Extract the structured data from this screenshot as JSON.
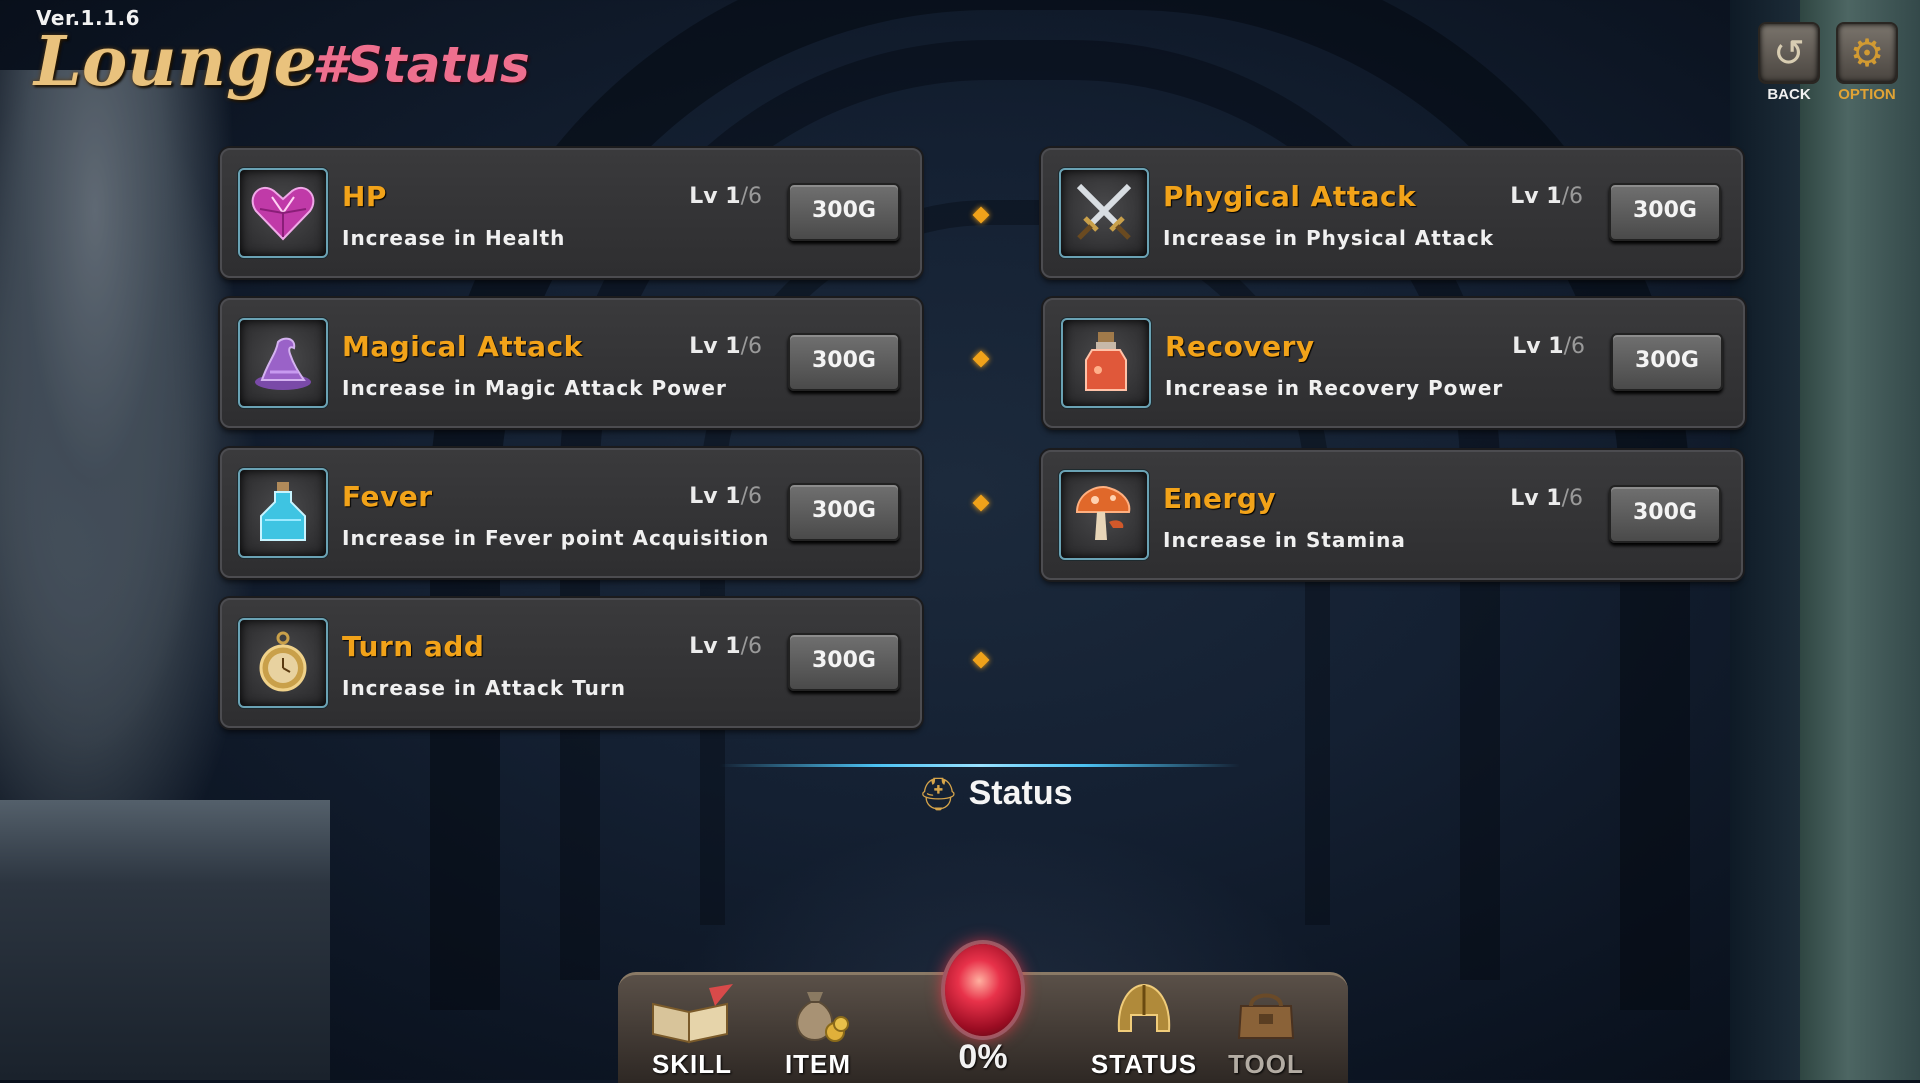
{
  "header": {
    "version": "Ver.1.1.6",
    "title": "Lounge",
    "subtitle": "#Status"
  },
  "top_buttons": {
    "back_label": "BACK",
    "option_label": "OPTION"
  },
  "stats": [
    {
      "name": "HP",
      "desc": "Increase in Health",
      "level": "1",
      "max": "6",
      "price": "300G",
      "icon": "heart-gem-icon"
    },
    {
      "name": "Magical Attack",
      "desc": "Increase in Magic Attack Power",
      "level": "1",
      "max": "6",
      "price": "300G",
      "icon": "wizard-hat-icon"
    },
    {
      "name": "Fever",
      "desc": "Increase in Fever point Acquisition",
      "level": "1",
      "max": "6",
      "price": "300G",
      "icon": "blue-potion-icon"
    },
    {
      "name": "Turn add",
      "desc": "Increase in Attack Turn",
      "level": "1",
      "max": "6",
      "price": "300G",
      "icon": "pocket-watch-icon"
    },
    {
      "name": "Phygical Attack",
      "desc": "Increase in Physical Attack",
      "level": "1",
      "max": "6",
      "price": "300G",
      "icon": "crossed-swords-icon"
    },
    {
      "name": "Recovery",
      "desc": "Increase in Recovery Power",
      "level": "1",
      "max": "6",
      "price": "300G",
      "icon": "red-potion-icon"
    },
    {
      "name": "Energy",
      "desc": "Increase in Stamina",
      "level": "1",
      "max": "6",
      "price": "300G",
      "icon": "mushroom-icon"
    }
  ],
  "level_prefix": "Lv",
  "section_label": "Status",
  "nav": {
    "skill": "SKILL",
    "item": "ITEM",
    "progress": "0%",
    "status": "STATUS",
    "tool": "TOOL"
  },
  "colors": {
    "stat_name": "#f2a319",
    "subtitle": "#ee6f8e",
    "title": "#e9c27d",
    "divider": "#4cc2f2"
  }
}
